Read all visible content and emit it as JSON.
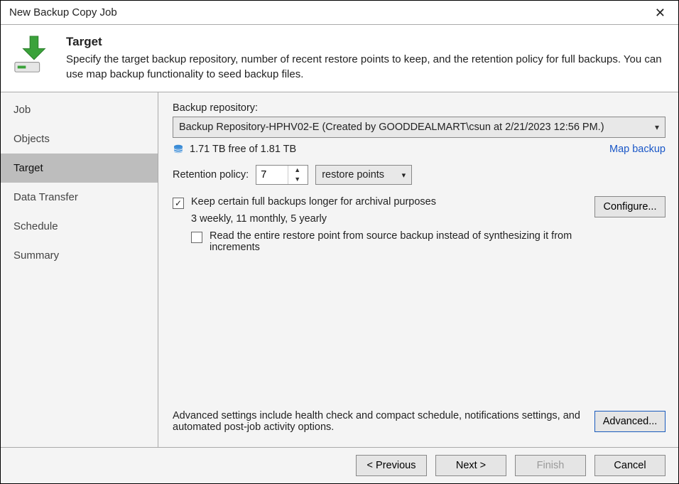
{
  "window": {
    "title": "New Backup Copy Job"
  },
  "header": {
    "title": "Target",
    "description": "Specify the target backup repository, number of recent restore points to keep, and the retention policy for full backups. You can use map backup functionality to seed backup files."
  },
  "sidebar": {
    "items": [
      {
        "label": "Job",
        "active": false
      },
      {
        "label": "Objects",
        "active": false
      },
      {
        "label": "Target",
        "active": true
      },
      {
        "label": "Data Transfer",
        "active": false
      },
      {
        "label": "Schedule",
        "active": false
      },
      {
        "label": "Summary",
        "active": false
      }
    ]
  },
  "main": {
    "repo_label": "Backup repository:",
    "repo_value": "Backup Repository-HPHV02-E (Created by GOODDEALMART\\csun at 2/21/2023 12:56 PM.)",
    "free_space": "1.71 TB free of 1.81 TB",
    "map_link": "Map backup",
    "retention_label": "Retention policy:",
    "retention_value": "7",
    "retention_unit": "restore points",
    "keep_checked": true,
    "keep_label": "Keep certain full backups longer for archival purposes",
    "keep_summary": "3 weekly, 11 monthly, 5 yearly",
    "read_checked": false,
    "read_label": "Read the entire restore point from source backup instead of synthesizing it from increments",
    "configure_btn": "Configure...",
    "advanced_text": "Advanced settings include health check and compact schedule, notifications settings, and automated post-job activity options.",
    "advanced_btn": "Advanced..."
  },
  "footer": {
    "previous": "< Previous",
    "next": "Next >",
    "finish": "Finish",
    "cancel": "Cancel"
  }
}
